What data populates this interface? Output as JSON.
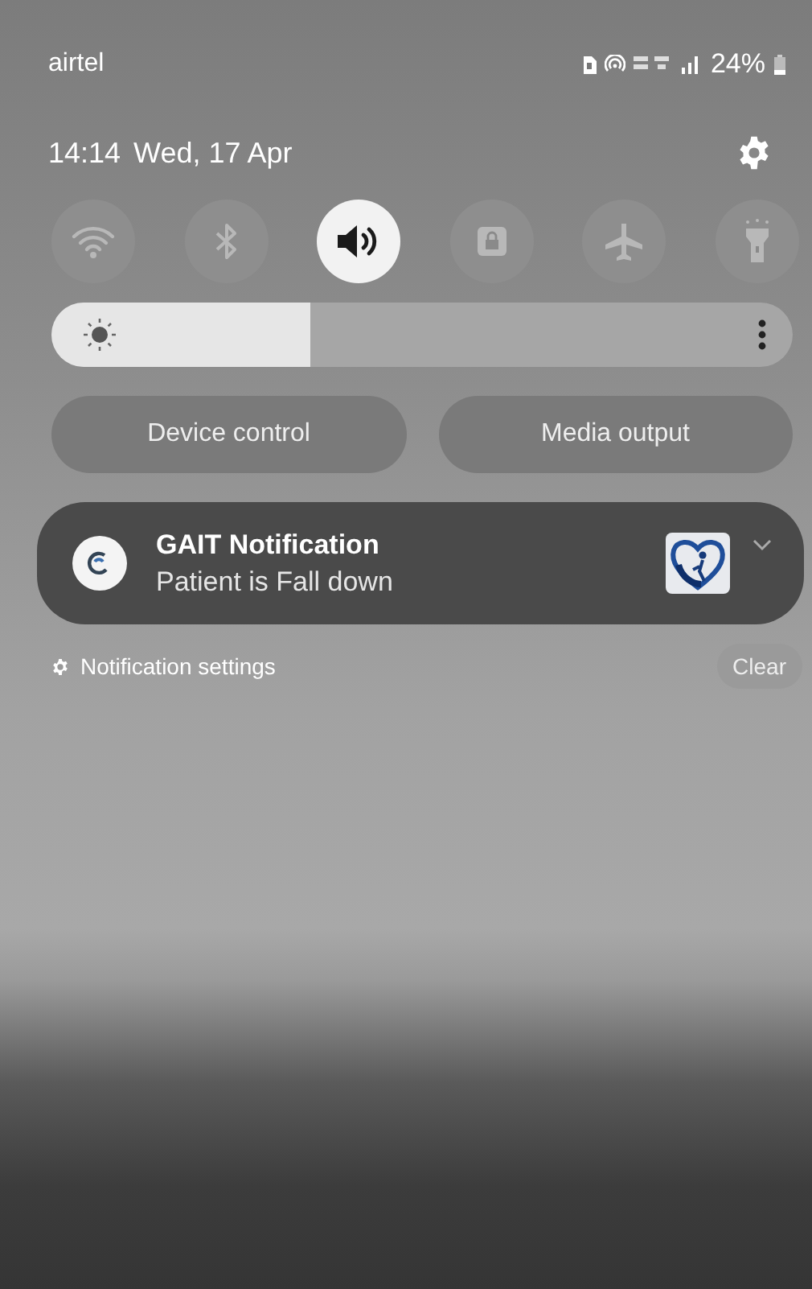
{
  "status_bar": {
    "carrier": "airtel",
    "battery_text": "24%"
  },
  "header": {
    "time": "14:14",
    "date": "Wed, 17 Apr"
  },
  "quick_toggles": [
    {
      "kind": "wifi",
      "on": false
    },
    {
      "kind": "bluetooth",
      "on": false
    },
    {
      "kind": "sound",
      "on": true
    },
    {
      "kind": "lock",
      "on": false
    },
    {
      "kind": "airplane",
      "on": false
    },
    {
      "kind": "flashlight",
      "on": false
    }
  ],
  "brightness": {
    "level": 0.35
  },
  "buttons": [
    "Device control",
    "Media output"
  ],
  "notifications": [
    {
      "title": "GAIT Notification",
      "text": "Patient is Fall down",
      "expanded": false
    }
  ],
  "footer": {
    "settings_label": "Notification settings",
    "clear_label": "Clear"
  }
}
